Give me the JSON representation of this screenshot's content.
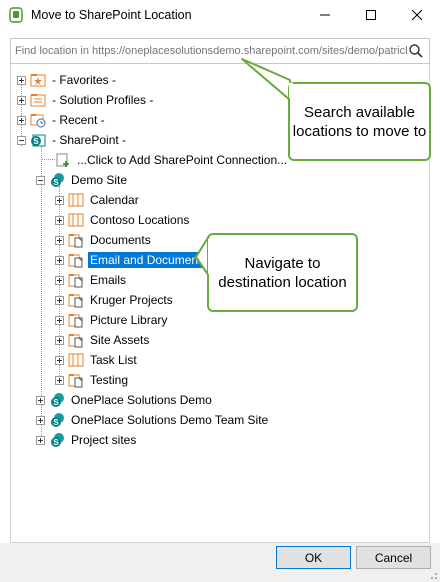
{
  "window": {
    "title": "Move to SharePoint Location",
    "minimize_glyph": "—",
    "maximize_glyph": "☐",
    "close_glyph": "✕"
  },
  "search": {
    "placeholder": "Find location in https://oneplacesolutionsdemo.sharepoint.com/sites/demo/patrick/...",
    "icon": "search-icon"
  },
  "tree": {
    "favorites": "- Favorites -",
    "solution_profiles": "- Solution Profiles -",
    "recent": "- Recent -",
    "sharepoint": "- SharePoint -",
    "add_connection": "...Click to Add SharePoint Connection...",
    "demo_site": "Demo Site",
    "demo_children": [
      "Calendar",
      "Contoso Locations",
      "Documents",
      "Email and Documents",
      "Emails",
      "Kruger Projects",
      "Picture Library",
      "Site Assets",
      "Task List",
      "Testing"
    ],
    "selected_item": "Email and Documents",
    "sites": [
      "OnePlace Solutions Demo",
      "OnePlace Solutions Demo Team Site",
      "Project sites"
    ]
  },
  "callouts": {
    "search_tip": "Search available locations to move to",
    "navigate_tip": "Navigate to destination location"
  },
  "footer": {
    "ok_label": "OK",
    "cancel_label": "Cancel"
  },
  "colors": {
    "selection": "#0078d7",
    "callout_border": "#6aab3d",
    "sharepoint_teal": "#038387",
    "folder_orange": "#e8822a"
  }
}
